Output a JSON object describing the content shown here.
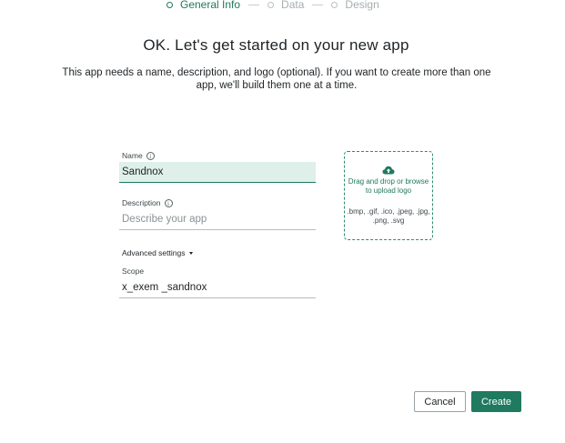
{
  "stepper": {
    "steps": [
      {
        "label": "General Info",
        "active": true
      },
      {
        "label": "Data",
        "active": false
      },
      {
        "label": "Design",
        "active": false
      }
    ]
  },
  "heading": {
    "title": "OK. Let's get started on your new app",
    "subtitle": "This app needs a name, description, and logo (optional). If you want to create more than one app, we'll build them one at a time."
  },
  "form": {
    "name": {
      "label": "Name",
      "value": "Sandnox",
      "info_icon": "info-icon"
    },
    "description": {
      "label": "Description",
      "value": "",
      "placeholder": "Describe your app",
      "info_icon": "info-icon"
    },
    "advanced_settings": {
      "label": "Advanced settings",
      "icon": "caret-down-icon"
    },
    "scope": {
      "label": "Scope",
      "value": "x_exem _sandnox"
    }
  },
  "upload": {
    "icon": "cloud-upload-icon",
    "primary_text": "Drag and drop or browse to upload logo",
    "formats": ".bmp, .gif, .ico, .jpeg, .jpg, .png, .svg"
  },
  "actions": {
    "cancel_label": "Cancel",
    "create_label": "Create"
  },
  "colors": {
    "accent": "#1d7a5e",
    "focused_input_bg": "#dff0ea"
  }
}
